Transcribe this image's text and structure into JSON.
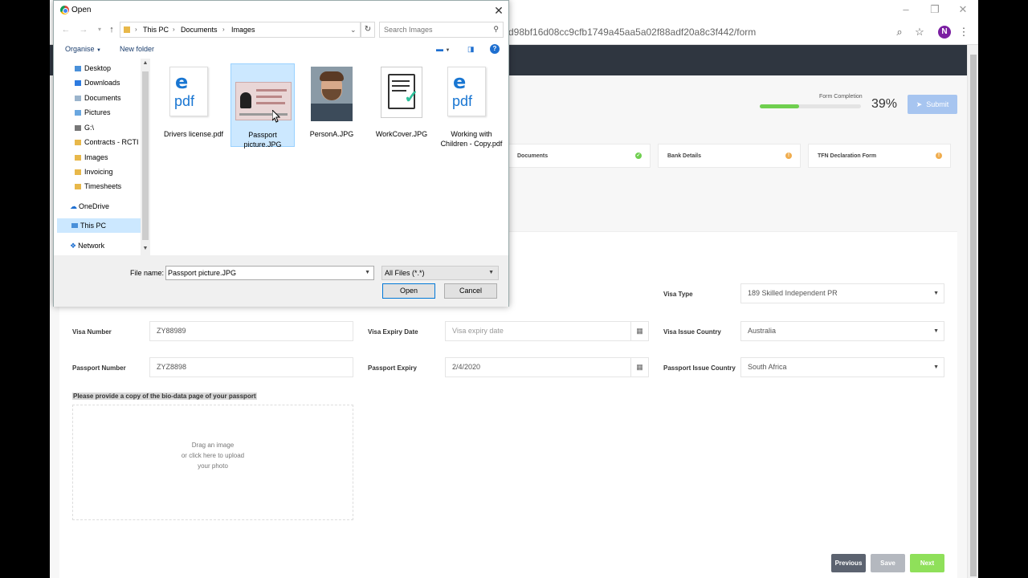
{
  "browser": {
    "url": "d98bf16d08cc9cfb1749a45aa5a02f88adf20a8c3f442/form",
    "avatar_letter": "N"
  },
  "form": {
    "progress_label": "Form Completion",
    "progress_percent": 39,
    "progress_text": "39%",
    "submit_label": "Submit",
    "steps": [
      {
        "label": "Documents",
        "status": "complete"
      },
      {
        "label": "Bank Details",
        "status": "warning"
      },
      {
        "label": "TFN Declaration Form",
        "status": "warning"
      }
    ],
    "fields": {
      "visa_type": {
        "label": "Visa Type",
        "value": "189 Skilled Independent PR"
      },
      "visa_number": {
        "label": "Visa Number",
        "value": "ZY88989"
      },
      "visa_expiry": {
        "label": "Visa Expiry Date",
        "placeholder": "Visa expiry date"
      },
      "visa_issue_country": {
        "label": "Visa Issue Country",
        "value": "Australia"
      },
      "passport_number": {
        "label": "Passport Number",
        "value": "ZYZ8898"
      },
      "passport_expiry": {
        "label": "Passport Expiry",
        "value": "2/4/2020"
      },
      "passport_issue_country": {
        "label": "Passport Issue Country",
        "value": "South Africa"
      }
    },
    "doc_label": "Please provide a copy of the bio-data page of your passport",
    "drop_line1": "Drag an image",
    "drop_line2": "or click here to upload",
    "drop_line3": "your photo",
    "buttons": {
      "previous": "Previous",
      "save": "Save",
      "next": "Next"
    }
  },
  "dialog": {
    "title": "Open",
    "path": [
      "This PC",
      "Documents",
      "Images"
    ],
    "search_placeholder": "Search Images",
    "toolbar": {
      "organise": "Organise",
      "new_folder": "New folder"
    },
    "tree": [
      {
        "label": "Desktop",
        "pinned": true
      },
      {
        "label": "Downloads",
        "pinned": true
      },
      {
        "label": "Documents",
        "pinned": true
      },
      {
        "label": "Pictures",
        "pinned": true
      },
      {
        "label": "G:\\",
        "pinned": true
      },
      {
        "label": "Contracts - RCTI",
        "pinned": false
      },
      {
        "label": "Images",
        "pinned": false
      },
      {
        "label": "Invoicing",
        "pinned": false
      },
      {
        "label": "Timesheets",
        "pinned": false
      },
      {
        "label": "OneDrive",
        "pinned": false
      },
      {
        "label": "This PC",
        "pinned": false
      },
      {
        "label": "Network",
        "pinned": false
      }
    ],
    "files": [
      {
        "name": "Drivers license.pdf",
        "type": "pdf"
      },
      {
        "name": "Passport picture.JPG",
        "type": "passport",
        "selected": true
      },
      {
        "name": "PersonA.JPG",
        "type": "photo"
      },
      {
        "name": "WorkCover.JPG",
        "type": "doc"
      },
      {
        "name": "Working with Children - Copy.pdf",
        "type": "pdf"
      }
    ],
    "file_name_label": "File name:",
    "file_name_value": "Passport picture.JPG",
    "file_type": "All Files (*.*)",
    "open_label": "Open",
    "cancel_label": "Cancel"
  },
  "colors": {
    "accent_green": "#6fcf4f",
    "submit_blue": "#a7c5f0",
    "navbar": "#2f3640",
    "previous_btn": "#5c6370",
    "save_btn": "#b4b8bf",
    "next_btn": "#8fe05a"
  }
}
